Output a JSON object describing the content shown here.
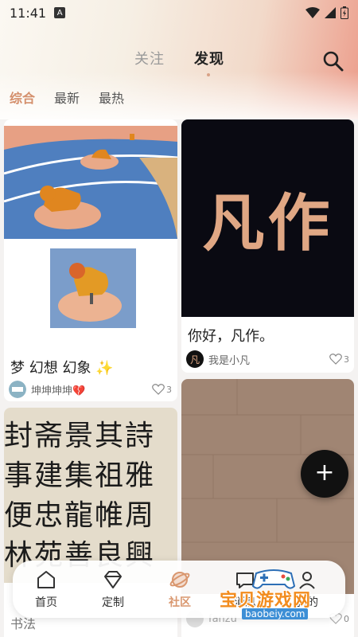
{
  "status_bar": {
    "time": "11:41",
    "notification_letter": "A"
  },
  "header": {
    "tabs": [
      {
        "label": "关注"
      },
      {
        "label": "发现"
      }
    ],
    "sub_tabs": [
      {
        "label": "综合"
      },
      {
        "label": "最新"
      },
      {
        "label": "最热"
      }
    ]
  },
  "feed": {
    "card1": {
      "title": "梦 幻想 幻象 ✨",
      "author": "坤坤坤坤💔",
      "likes": "3"
    },
    "card2": {
      "title": "你好，凡作。",
      "author": "我是小凡",
      "likes": "3",
      "logo_text": "凡作",
      "avatar_char": "凡"
    },
    "card3": {
      "title": "书法",
      "calligraphy_lines": [
        "封斋景其詩",
        "事建集祖雅",
        "便忠龍帷周",
        "林苑善良興"
      ]
    },
    "card4": {
      "author": "fanzu",
      "likes": "0"
    }
  },
  "fab": {
    "label": "+"
  },
  "bottom_nav": {
    "items": [
      {
        "label": "首页",
        "icon": "home-icon"
      },
      {
        "label": "定制",
        "icon": "diamond-icon"
      },
      {
        "label": "社区",
        "icon": "planet-icon"
      },
      {
        "label": "消息",
        "icon": "chat-icon"
      },
      {
        "label": "我的",
        "icon": "user-icon"
      }
    ]
  },
  "watermark": {
    "title": "宝贝游戏网",
    "url": "baobeiy.com"
  },
  "colors": {
    "accent": "#d9976f",
    "fab": "#111111",
    "dark_card": "#0a0a12"
  }
}
